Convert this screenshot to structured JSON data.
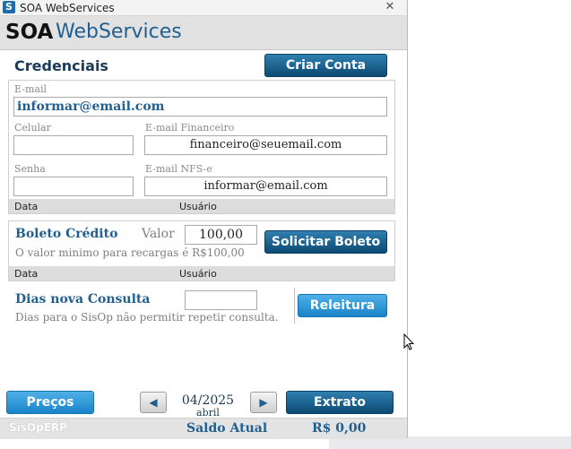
{
  "window": {
    "title": "SOA WebServices",
    "app_icon": "S"
  },
  "brand": {
    "primary": "SOA",
    "secondary": "WebServices"
  },
  "credenciais": {
    "heading": "Credenciais",
    "create_account_label": "Criar Conta",
    "email_label": "E-mail",
    "email_value": "informar@email.com",
    "celular_label": "Celular",
    "celular_value": "",
    "email_financeiro_label": "E-mail Financeiro",
    "email_financeiro_value": "financeiro@seuemail.com",
    "senha_label": "Senha",
    "senha_value": "",
    "email_nfse_label": "E-mail NFS-e",
    "email_nfse_value": "informar@email.com",
    "grid_columns": [
      "Data",
      "Usuário"
    ]
  },
  "boleto": {
    "heading": "Boleto Crédito",
    "valor_label": "Valor",
    "valor_value": "100,00",
    "button_label": "Solicitar Boleto",
    "hint": "O valor minimo para recargas é R$100,00",
    "grid_columns": [
      "Data",
      "Usuário"
    ]
  },
  "consulta": {
    "heading": "Dias nova Consulta",
    "value": "",
    "hint": "Dias para o SisOp não permitir repetir consulta.",
    "button_label": "Releitura"
  },
  "footer": {
    "precos_label": "Preços",
    "period": "04/2025",
    "period_month": "abril",
    "extrato_label": "Extrato"
  },
  "status": {
    "app_name": "SisOpERP",
    "saldo_label": "Saldo Atual",
    "saldo_value": "R$ 0,00"
  },
  "colors": {
    "accent_dark": "#0d4a73",
    "accent_light": "#1a84c8",
    "heading_blue": "#1f5f91"
  },
  "icons": {
    "close": "close-icon",
    "prev": "chevron-left-icon",
    "next": "chevron-right-icon",
    "cursor": "mouse-cursor-icon"
  }
}
